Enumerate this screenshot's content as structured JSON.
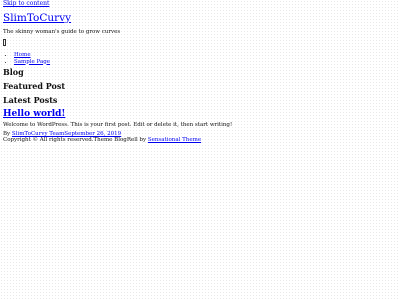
{
  "skip_link": "Skip to content",
  "site": {
    "title": "SlimToCurvy",
    "description": "The skinny woman's guide to grow curves"
  },
  "menu": {
    "toggle_icon": "menu-toggle-icon",
    "items": [
      {
        "label": "Home"
      },
      {
        "label": "Sample Page"
      }
    ]
  },
  "headings": {
    "blog": "Blog",
    "featured": "Featured Post",
    "latest": "Latest Posts"
  },
  "post": {
    "title": "Hello world!",
    "excerpt": "Welcome to WordPress. This is your first post. Edit or delete it, then start writing!",
    "by": "By",
    "author": "SlimToCurvy Team",
    "date": "September 26, 2019"
  },
  "footer": {
    "copyright": "Copyright © All rights reserved.Theme BlogRell by",
    "theme_link": "Sensational Theme"
  }
}
